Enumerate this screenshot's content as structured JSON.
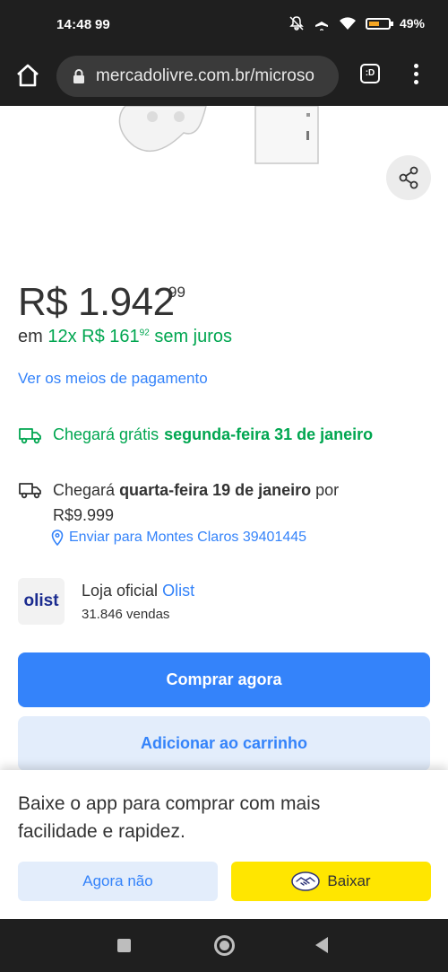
{
  "status_bar": {
    "time": "14:48",
    "extra": "99",
    "battery": "49%"
  },
  "browser": {
    "url": "mercadolivre.com.br/microso",
    "tab_label": ":D"
  },
  "product": {
    "price_main": "R$ 1.942",
    "price_cents": "99",
    "installments_prefix": "em",
    "installments_value": "12x R$ 161",
    "installments_cents": "92",
    "installments_suffix": "sem juros",
    "payment_link": "Ver os meios de pagamento"
  },
  "shipping": {
    "free_prefix": "Chegará grátis",
    "free_date": "segunda-feira 31 de janeiro",
    "paid_prefix": "Chegará",
    "paid_date": "quarta-feira 19 de janeiro",
    "paid_by": "por",
    "paid_price": "R$9.999",
    "address": "Enviar para Montes Claros 39401445"
  },
  "seller": {
    "logo_text": "olist",
    "label": "Loja oficial",
    "name": "Olist",
    "sales": "31.846 vendas"
  },
  "actions": {
    "buy": "Comprar agora",
    "cart": "Adicionar ao carrinho"
  },
  "app_banner": {
    "text": "Baixe o app para comprar com mais facilidade e rapidez.",
    "dismiss": "Agora não",
    "download": "Baixar"
  },
  "colors": {
    "accent_blue": "#3483fa",
    "green": "#00a650",
    "yellow": "#ffe600"
  }
}
